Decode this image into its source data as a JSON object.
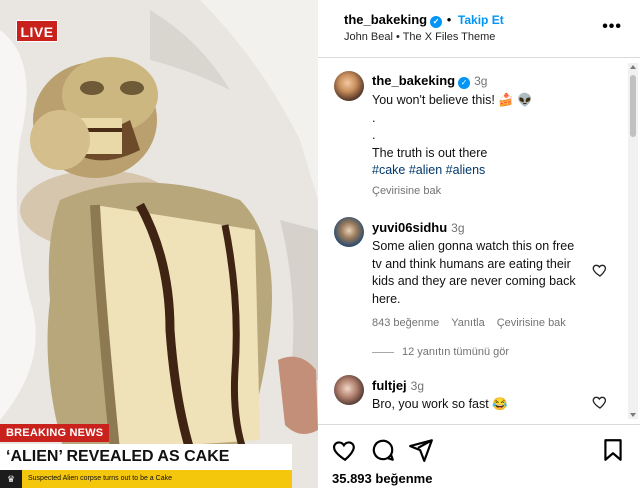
{
  "video": {
    "live_label": "LIVE",
    "breaking_label": "BREAKING NEWS",
    "headline": "‘ALIEN’ REVEALED AS CAKE",
    "ticker": "Suspected Alien corpse turns out to be a Cake"
  },
  "post": {
    "username": "the_bakeking",
    "follow_label": "Takip Et",
    "separator": "•",
    "audio": "John Beal • The X Files Theme",
    "more_icon": "more-dots-icon"
  },
  "caption": {
    "username": "the_bakeking",
    "time": "3g",
    "line1": "You won't believe this! 🍰 👽",
    "line2": ".",
    "line3": ".",
    "line4": "The truth is out there",
    "hashtags": "#cake #alien #aliens",
    "translate": "Çevirisine bak"
  },
  "comments": [
    {
      "username": "yuvi06sidhu",
      "time": "3g",
      "text": "Some alien gonna watch this on free tv and think humans are eating their kids and they are never coming back here.",
      "likes": "843 beğenme",
      "reply": "Yanıtla",
      "translate": "Çevirisine bak",
      "replies_label": "12 yanıtın tümünü gör"
    },
    {
      "username": "fultjej",
      "time": "3g",
      "text": "Bro, you work so fast 😂",
      "likes": "",
      "reply": "",
      "translate": ""
    }
  ],
  "actions": {
    "like_icon": "heart-icon",
    "comment_icon": "comment-icon",
    "share_icon": "share-icon",
    "save_icon": "bookmark-icon",
    "likes_count": "35.893 beğenme"
  },
  "colors": {
    "accent": "#0095f6",
    "breaking_red": "#c9221c",
    "ticker_yellow": "#f4c60c",
    "muted": "#737373"
  }
}
